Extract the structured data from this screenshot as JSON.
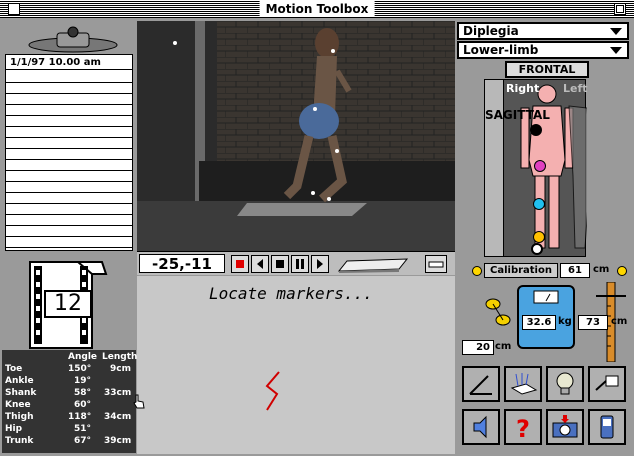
{
  "window": {
    "title": "Motion Toolbox"
  },
  "clipboard": {
    "date": "1/1/97 10.00 am"
  },
  "film": {
    "frame_count": "12"
  },
  "joints": {
    "headers": {
      "angle": "Angle",
      "length": "Length"
    },
    "rows": [
      {
        "name": "Toe",
        "angle": "150°",
        "length": "9cm"
      },
      {
        "name": "Ankle",
        "angle": "19°",
        "length": ""
      },
      {
        "name": "Shank",
        "angle": "58°",
        "length": "33cm"
      },
      {
        "name": "Knee",
        "angle": "60°",
        "length": ""
      },
      {
        "name": "Thigh",
        "angle": "118°",
        "length": "34cm"
      },
      {
        "name": "Hip",
        "angle": "51°",
        "length": ""
      },
      {
        "name": "Trunk",
        "angle": "67°",
        "length": "39cm"
      }
    ]
  },
  "video": {
    "coordinates": "-25,-11"
  },
  "message": {
    "text": "Locate markers..."
  },
  "selectors": {
    "condition": "Diplegia",
    "region": "Lower-limb"
  },
  "body_view": {
    "frontal_label": "FRONTAL",
    "sagittal_label": "SAGITTAL",
    "right_label": "Right",
    "left_label": "Left",
    "marker_colors": [
      "#000000",
      "#e040c0",
      "#20c0f0",
      "#ffc000"
    ]
  },
  "calibration": {
    "label": "Calibration",
    "value": "61",
    "unit": "cm"
  },
  "weight": {
    "value": "32.6",
    "unit": "kg"
  },
  "height": {
    "value": "73",
    "unit": "cm"
  },
  "tape": {
    "value": "20",
    "unit": "cm"
  },
  "tools": [
    "angle-tool",
    "scanner-tool",
    "lightbulb-tool",
    "plug-tool",
    "speaker-tool",
    "help-tool",
    "camera-tool",
    "phone-tool"
  ]
}
